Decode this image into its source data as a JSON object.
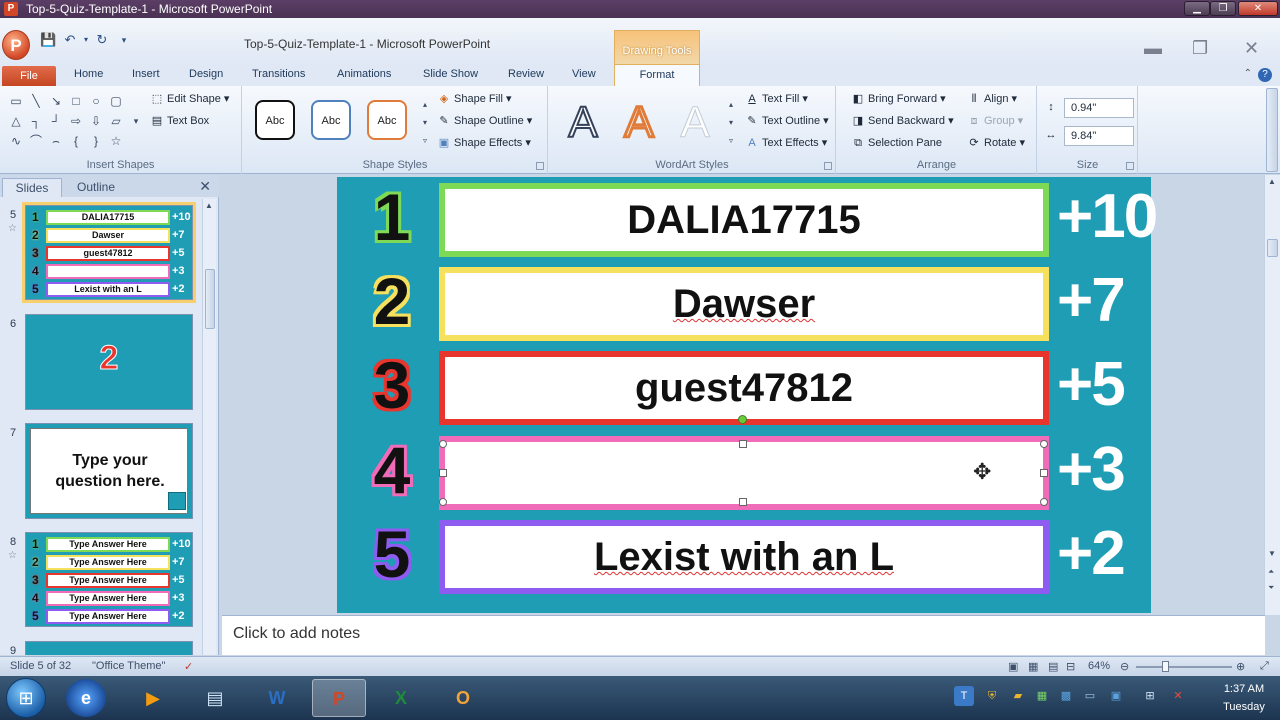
{
  "window": {
    "title": "Top-5-Quiz-Template-1 - Microsoft PowerPoint",
    "app_icon": "P"
  },
  "qat": {
    "doc_title": "Top-5-Quiz-Template-1  -  Microsoft PowerPoint",
    "drawing_tools": "Drawing Tools"
  },
  "tabs": {
    "file": "File",
    "home": "Home",
    "insert": "Insert",
    "design": "Design",
    "transitions": "Transitions",
    "animations": "Animations",
    "slideshow": "Slide Show",
    "review": "Review",
    "view": "View",
    "format": "Format"
  },
  "ribbon": {
    "insert_shapes": {
      "label": "Insert Shapes",
      "edit_shape": "Edit Shape",
      "text_box": "Text Box"
    },
    "shape_styles": {
      "label": "Shape Styles",
      "abc": "Abc",
      "shape_fill": "Shape Fill",
      "shape_outline": "Shape Outline",
      "shape_effects": "Shape Effects"
    },
    "wordart_styles": {
      "label": "WordArt Styles",
      "letter": "A",
      "text_fill": "Text Fill",
      "text_outline": "Text Outline",
      "text_effects": "Text Effects"
    },
    "arrange": {
      "label": "Arrange",
      "bring_forward": "Bring Forward",
      "send_backward": "Send Backward",
      "selection_pane": "Selection Pane",
      "align": "Align",
      "group": "Group",
      "rotate": "Rotate"
    },
    "size": {
      "label": "Size",
      "height": "0.94\"",
      "width": "9.84\""
    }
  },
  "side_panel": {
    "tab_slides": "Slides",
    "tab_outline": "Outline",
    "thumbs": {
      "s5": {
        "number": "5",
        "rows": [
          {
            "n": "1",
            "text": "DALIA17715",
            "pts": "+10"
          },
          {
            "n": "2",
            "text": "Dawser",
            "pts": "+7"
          },
          {
            "n": "3",
            "text": "guest47812",
            "pts": "+5"
          },
          {
            "n": "4",
            "text": "",
            "pts": "+3"
          },
          {
            "n": "5",
            "text": "Lexist with an L",
            "pts": "+2"
          }
        ]
      },
      "s6": {
        "number": "6",
        "big": "2"
      },
      "s7": {
        "number": "7",
        "text": "Type your question here."
      },
      "s8": {
        "number": "8",
        "rows": [
          {
            "n": "1",
            "text": "Type Answer Here",
            "pts": "+10"
          },
          {
            "n": "2",
            "text": "Type Answer Here",
            "pts": "+7"
          },
          {
            "n": "3",
            "text": "Type Answer Here",
            "pts": "+5"
          },
          {
            "n": "4",
            "text": "Type Answer Here",
            "pts": "+3"
          },
          {
            "n": "5",
            "text": "Type Answer Here",
            "pts": "+2"
          }
        ]
      },
      "s9": {
        "number": "9"
      }
    }
  },
  "slide": {
    "rows": [
      {
        "n": "1",
        "text": "DALIA17715",
        "pts": "+10",
        "color": "#7ed957"
      },
      {
        "n": "2",
        "text": "Dawser",
        "pts": "+7",
        "color": "#f6e15f"
      },
      {
        "n": "3",
        "text": "guest47812",
        "pts": "+5",
        "color": "#e8352e"
      },
      {
        "n": "4",
        "text": "",
        "pts": "+3",
        "color": "#f06bb8"
      },
      {
        "n": "5",
        "text": "Lexist with an L",
        "pts": "+2",
        "color": "#8e5cf0"
      }
    ]
  },
  "notes": {
    "placeholder": "Click to add notes"
  },
  "status": {
    "slide_of": "Slide 5 of 32",
    "theme": "\"Office Theme\"",
    "zoom": "64%"
  },
  "taskbar": {
    "time": "1:37 AM",
    "day": "Tuesday"
  },
  "colors": {
    "slide_bg": "#1e9db4",
    "file_tab": "#d24726",
    "drawing_tools": "#f2b65c"
  }
}
